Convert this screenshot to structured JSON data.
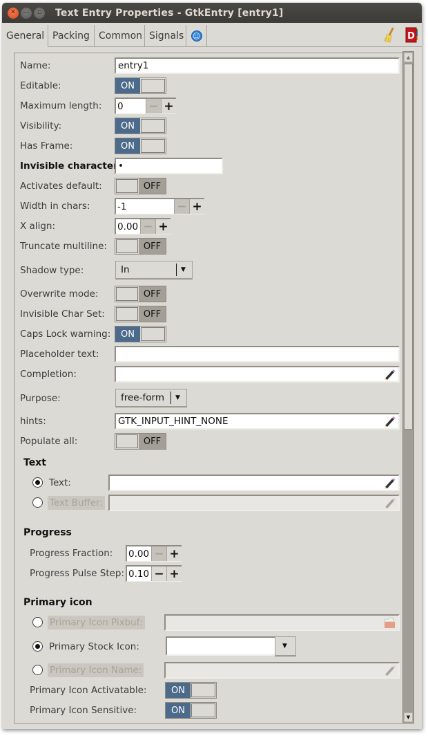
{
  "window": {
    "title": "Text Entry Properties - GtkEntry [entry1]",
    "controls": [
      "close",
      "minimize",
      "maximize"
    ]
  },
  "tabs": [
    {
      "label": "General",
      "active": true
    },
    {
      "label": "Packing",
      "active": false
    },
    {
      "label": "Common",
      "active": false
    },
    {
      "label": "Signals",
      "active": false
    },
    {
      "label": "",
      "icon": "accessibility-icon",
      "active": false
    }
  ],
  "toolbar": {
    "clear_icon": "broom-icon",
    "docs_icon": "devhelp-book-icon"
  },
  "properties": {
    "name": {
      "label": "Name:",
      "value": "entry1"
    },
    "editable": {
      "label": "Editable:",
      "state": "ON"
    },
    "max_length": {
      "label": "Maximum length:",
      "value": "0",
      "minus": "−",
      "plus": "+"
    },
    "visibility": {
      "label": "Visibility:",
      "state": "ON"
    },
    "has_frame": {
      "label": "Has Frame:",
      "state": "ON"
    },
    "invisible_char": {
      "label": "Invisible character:",
      "value": "•"
    },
    "activates_default": {
      "label": "Activates default:",
      "state": "OFF"
    },
    "width_chars": {
      "label": "Width in chars:",
      "value": "-1",
      "minus": "−",
      "plus": "+"
    },
    "xalign": {
      "label": "X align:",
      "value": "0.00",
      "minus": "−",
      "plus": "+"
    },
    "truncate_multiline": {
      "label": "Truncate multiline:",
      "state": "OFF"
    },
    "shadow_type": {
      "label": "Shadow type:",
      "value": "In"
    },
    "overwrite_mode": {
      "label": "Overwrite mode:",
      "state": "OFF"
    },
    "invisible_char_set": {
      "label": "Invisible Char Set:",
      "state": "OFF"
    },
    "caps_lock_warning": {
      "label": "Caps Lock warning:",
      "state": "ON"
    },
    "placeholder_text": {
      "label": "Placeholder text:",
      "value": ""
    },
    "completion": {
      "label": "Completion:",
      "value": ""
    },
    "purpose": {
      "label": "Purpose:",
      "value": "free-form"
    },
    "hints": {
      "label": "hints:",
      "value": "GTK_INPUT_HINT_NONE"
    },
    "populate_all": {
      "label": "Populate all:",
      "state": "OFF"
    }
  },
  "text_section": {
    "title": "Text",
    "text": {
      "label": "Text:",
      "value": "",
      "selected": true
    },
    "text_buffer": {
      "label": "Text Buffer:",
      "value": "",
      "selected": false,
      "disabled": true
    }
  },
  "progress_section": {
    "title": "Progress",
    "fraction": {
      "label": "Progress Fraction:",
      "value": "0.00",
      "minus": "−",
      "plus": "+"
    },
    "pulse_step": {
      "label": "Progress Pulse Step:",
      "value": "0.10",
      "minus": "−",
      "plus": "+"
    }
  },
  "primary_icon_section": {
    "title": "Primary icon",
    "pixbuf": {
      "label": "Primary Icon Pixbuf:",
      "value": "",
      "selected": false,
      "disabled": true
    },
    "stock": {
      "label": "Primary Stock Icon:",
      "value": "",
      "selected": true
    },
    "icon_name": {
      "label": "Primary Icon Name:",
      "value": "",
      "selected": false,
      "disabled": true
    },
    "activatable": {
      "label": "Primary Icon Activatable:",
      "state": "ON"
    },
    "sensitive": {
      "label": "Primary Icon Sensitive:",
      "state": "ON"
    }
  },
  "colors": {
    "switch_on": "#4c6a8a",
    "switch_off": "#a39f97",
    "window_bg": "#dcdad5",
    "titlebar": "#3c3b37",
    "close_button": "#dc4a1f"
  }
}
